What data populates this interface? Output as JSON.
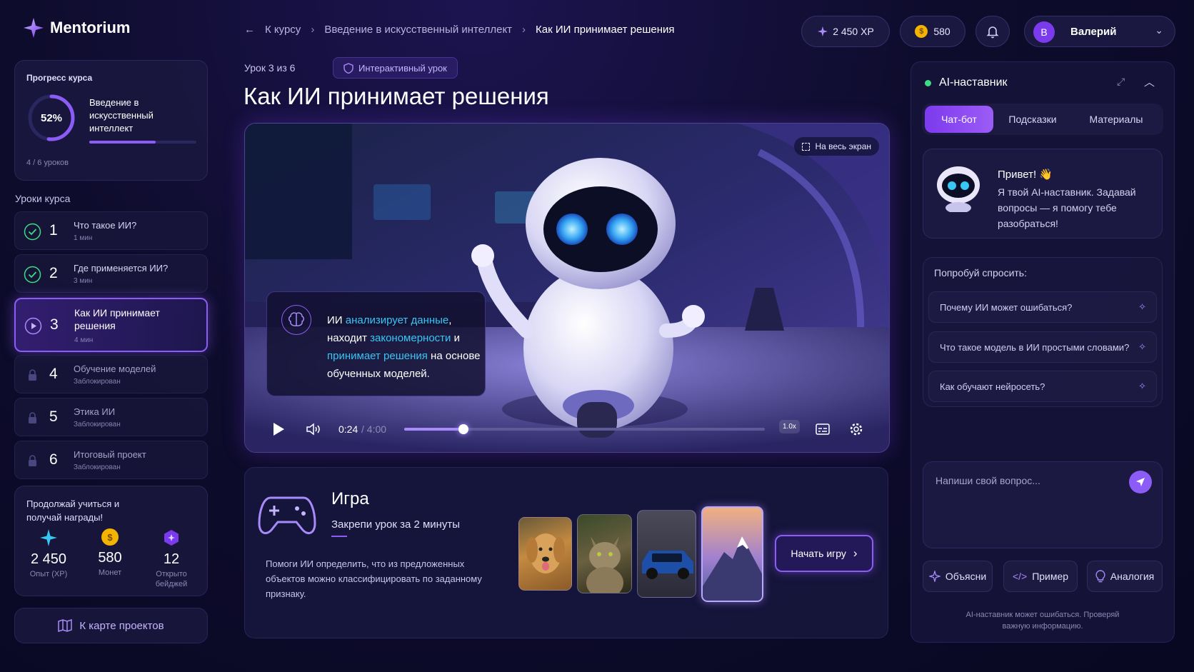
{
  "app": {
    "name": "Mentorium"
  },
  "breadcrumb": {
    "back": "К курсу",
    "course": "Введение в искусственный интеллект",
    "current": "Как ИИ принимает решения"
  },
  "header": {
    "xp": "2 450 XP",
    "coins": "580",
    "user_initial": "В",
    "user_name": "Валерий"
  },
  "progress": {
    "label": "Прогресс курса",
    "percent_text": "52%",
    "percent": 52,
    "course_title": "Введение в искусственный интеллект",
    "lessons_done": "4 / 6 уроков"
  },
  "lessons_heading": "Уроки курса",
  "lessons": [
    {
      "num": "1",
      "title": "Что такое ИИ?",
      "meta": "1 мин",
      "state": "done"
    },
    {
      "num": "2",
      "title": "Где применяется ИИ?",
      "meta": "3 мин",
      "state": "done"
    },
    {
      "num": "3",
      "title": "Как ИИ принимает решения",
      "meta": "4 мин",
      "state": "active"
    },
    {
      "num": "4",
      "title": "Обучение моделей",
      "meta": "Заблокирован",
      "state": "locked"
    },
    {
      "num": "5",
      "title": "Этика ИИ",
      "meta": "Заблокирован",
      "state": "locked"
    },
    {
      "num": "6",
      "title": "Итоговый проект",
      "meta": "Заблокирован",
      "state": "locked"
    }
  ],
  "rewards": {
    "text": "Продолжай учиться и получай награды!",
    "stats": [
      {
        "value": "2 450",
        "label": "Опыт (XP)"
      },
      {
        "value": "580",
        "label": "Монет"
      },
      {
        "value": "12",
        "label": "Открыто бейджей"
      }
    ]
  },
  "map_button": "К карте проектов",
  "lesson": {
    "counter": "Урок 3 из 6",
    "badge": "Интерактивный урок",
    "title": "Как ИИ принимает решения"
  },
  "video": {
    "fullscreen": "На весь экран",
    "caption": {
      "p1": "ИИ ",
      "h1": "анализирует данные",
      "p2": ", находит ",
      "h2": "закономерности",
      "p3": " и ",
      "h3": "принимает решения",
      "p4": " на основе обученных моделей."
    },
    "time_current": "0:24",
    "time_total": " / 4:00",
    "progress": 0.1,
    "speed": "1.0x"
  },
  "game": {
    "title": "Игра",
    "subtitle": "Закрепи урок за 2 минуты",
    "desc": "Помоги ИИ определить, что из предложенных объектов можно классифицировать по заданному признаку.",
    "start": "Начать игру"
  },
  "mentor": {
    "title": "AI-наставник",
    "tabs": [
      "Чат-бот",
      "Подсказки",
      "Материалы"
    ],
    "greeting_title": "Привет! 👋",
    "greeting_text": "Я твой AI-наставник. Задавай вопросы — я помогу тебе разобраться!",
    "try_label": "Попробуй спросить:",
    "suggestions": [
      "Почему ИИ может ошибаться?",
      "Что такое модель в ИИ простыми словами?",
      "Как обучают нейросеть?"
    ],
    "input_placeholder": "Напиши свой вопрос...",
    "quick": [
      "Объясни",
      "Пример",
      "Аналогия"
    ],
    "disclaimer": "AI-наставник может ошибаться. Проверяй важную информацию."
  },
  "colors": {
    "accent": "#8b5cf6",
    "accent_light": "#a78bfa",
    "highlight": "#38c6f4",
    "done": "#3ddc84",
    "coin": "#f5b301"
  }
}
